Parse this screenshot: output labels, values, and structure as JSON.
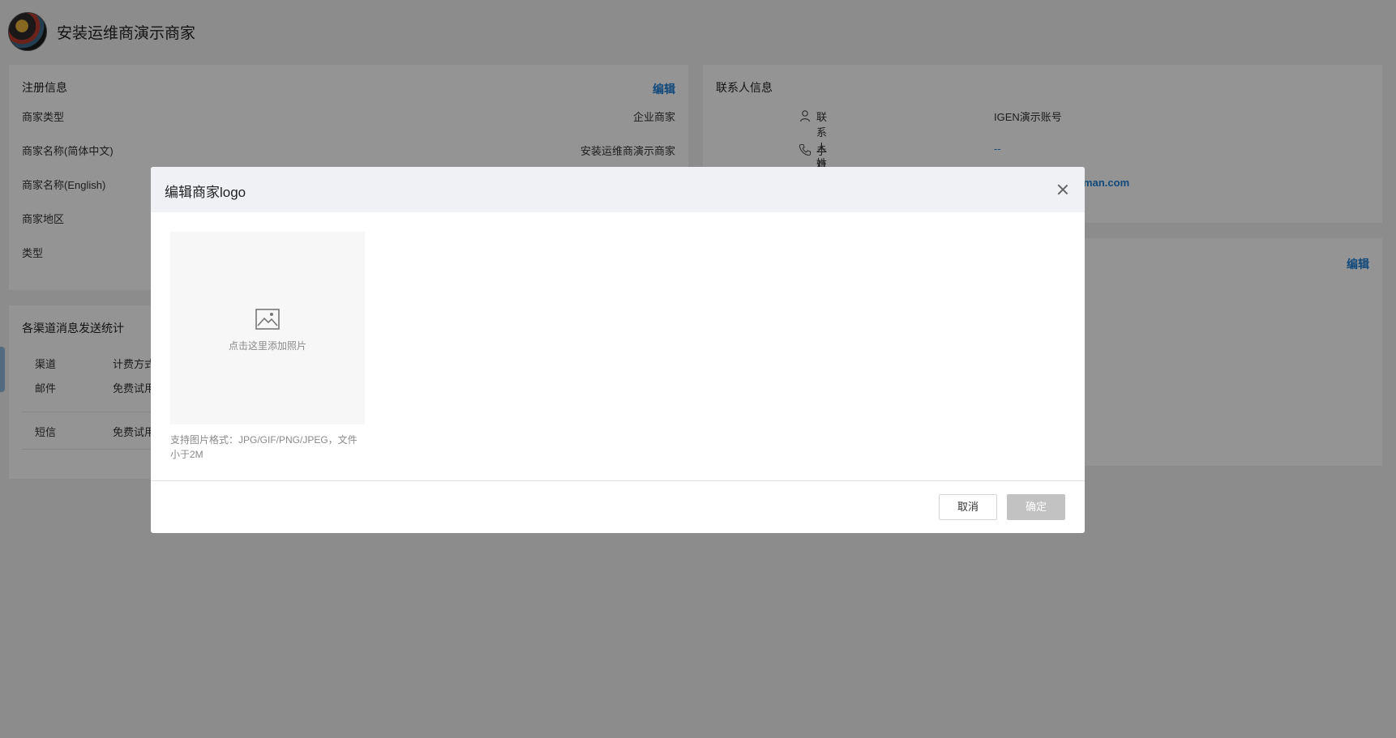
{
  "header": {
    "merchant_name": "安装运维商演示商家"
  },
  "registration": {
    "title": "注册信息",
    "edit": "编辑",
    "rows": [
      {
        "label": "商家类型",
        "value": "企业商家"
      },
      {
        "label": "商家名称(简体中文)",
        "value": "安装运维商演示商家"
      },
      {
        "label": "商家名称(English)",
        "value": ""
      },
      {
        "label": "商家地区",
        "value": ""
      },
      {
        "label": "类型",
        "value": ""
      }
    ]
  },
  "contact": {
    "title": "联系人信息",
    "rows": [
      {
        "icon": "user-icon",
        "label": "联系人姓名",
        "value": "IGEN演示账号"
      },
      {
        "icon": "phone-icon",
        "label": "手机号",
        "value": "--"
      },
      {
        "icon": "mail-icon",
        "label": "",
        "value": "rman.com"
      }
    ]
  },
  "second_card": {
    "edit": "编辑"
  },
  "stats": {
    "title": "各渠道消息发送统计",
    "columns": [
      "渠道",
      "计费方式"
    ],
    "rows": [
      [
        "邮件",
        "免费试用"
      ],
      [
        "短信",
        "免费试用"
      ]
    ]
  },
  "modal": {
    "title": "编辑商家logo",
    "upload_text": "点击这里添加照片",
    "hint": "支持图片格式：JPG/GIF/PNG/JPEG，文件小于2M",
    "cancel": "取消",
    "confirm": "确定"
  },
  "colors": {
    "link": "#1f7fd6",
    "overlay": "rgba(0,0,0,0.42)",
    "disabled_button": "#c2c2c2"
  }
}
